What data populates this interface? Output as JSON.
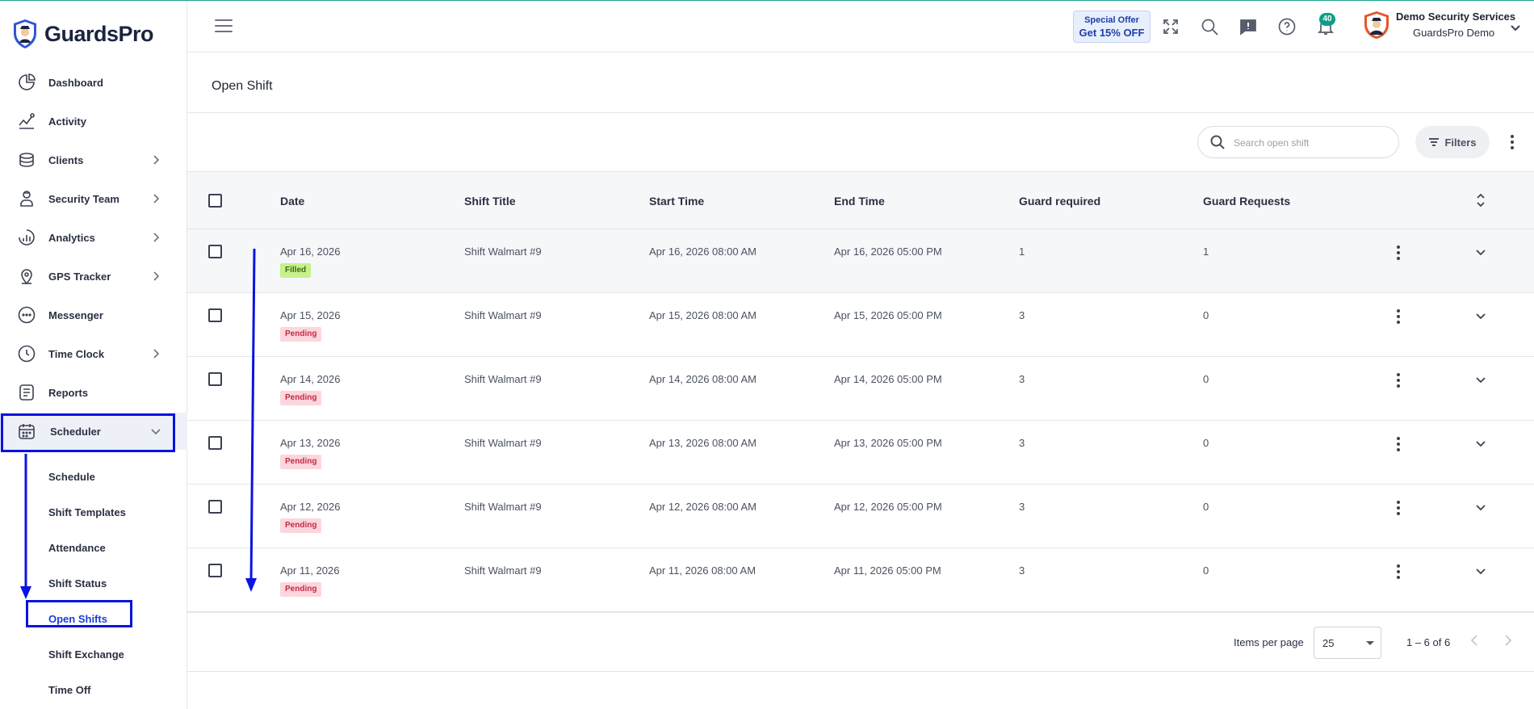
{
  "app": {
    "name": "GuardsPro",
    "page_title": "Open Shift"
  },
  "sidebar": {
    "items": [
      {
        "label": "Dashboard",
        "icon": "dashboard-icon",
        "expandable": false
      },
      {
        "label": "Activity",
        "icon": "activity-icon",
        "expandable": false
      },
      {
        "label": "Clients",
        "icon": "clients-icon",
        "expandable": true
      },
      {
        "label": "Security Team",
        "icon": "security-team-icon",
        "expandable": true
      },
      {
        "label": "Analytics",
        "icon": "analytics-icon",
        "expandable": true
      },
      {
        "label": "GPS Tracker",
        "icon": "gps-icon",
        "expandable": true
      },
      {
        "label": "Messenger",
        "icon": "messenger-icon",
        "expandable": false
      },
      {
        "label": "Time Clock",
        "icon": "clock-icon",
        "expandable": true
      },
      {
        "label": "Reports",
        "icon": "reports-icon",
        "expandable": false
      },
      {
        "label": "Scheduler",
        "icon": "calendar-icon",
        "expandable": true,
        "expanded": true
      }
    ],
    "scheduler_sub": [
      "Schedule",
      "Shift Templates",
      "Attendance",
      "Shift Status",
      "Open Shifts",
      "Shift Exchange",
      "Time Off"
    ],
    "active_sub": "Open Shifts"
  },
  "header": {
    "offer_line1": "Special Offer",
    "offer_line2": "Get 15% OFF",
    "notifications_count": "40",
    "user_name": "Demo Security Services",
    "user_org": "GuardsPro Demo"
  },
  "toolbar": {
    "search_placeholder": "Search open shift",
    "filters_label": "Filters"
  },
  "table": {
    "columns": [
      "Date",
      "Shift Title",
      "Start Time",
      "End Time",
      "Guard required",
      "Guard Requests"
    ],
    "rows": [
      {
        "date": "Apr 16, 2026",
        "status": "Filled",
        "title": "Shift Walmart #9",
        "start": "Apr 16, 2026 08:00 AM",
        "end": "Apr 16, 2026 05:00 PM",
        "required": "1",
        "requests": "1"
      },
      {
        "date": "Apr 15, 2026",
        "status": "Pending",
        "title": "Shift Walmart #9",
        "start": "Apr 15, 2026 08:00 AM",
        "end": "Apr 15, 2026 05:00 PM",
        "required": "3",
        "requests": "0"
      },
      {
        "date": "Apr 14, 2026",
        "status": "Pending",
        "title": "Shift Walmart #9",
        "start": "Apr 14, 2026 08:00 AM",
        "end": "Apr 14, 2026 05:00 PM",
        "required": "3",
        "requests": "0"
      },
      {
        "date": "Apr 13, 2026",
        "status": "Pending",
        "title": "Shift Walmart #9",
        "start": "Apr 13, 2026 08:00 AM",
        "end": "Apr 13, 2026 05:00 PM",
        "required": "3",
        "requests": "0"
      },
      {
        "date": "Apr 12, 2026",
        "status": "Pending",
        "title": "Shift Walmart #9",
        "start": "Apr 12, 2026 08:00 AM",
        "end": "Apr 12, 2026 05:00 PM",
        "required": "3",
        "requests": "0"
      },
      {
        "date": "Apr 11, 2026",
        "status": "Pending",
        "title": "Shift Walmart #9",
        "start": "Apr 11, 2026 08:00 AM",
        "end": "Apr 11, 2026 05:00 PM",
        "required": "3",
        "requests": "0"
      }
    ]
  },
  "pagination": {
    "items_per_page_label": "Items per page",
    "items_per_page": "25",
    "range": "1 – 6 of 6"
  },
  "colors": {
    "accent": "#1b3de0",
    "annotation": "#0a13e0",
    "filled_bg": "#c7f08e",
    "pending_bg": "#fcd6dc",
    "pending_text": "#c42945",
    "badge": "#0e9e88"
  }
}
